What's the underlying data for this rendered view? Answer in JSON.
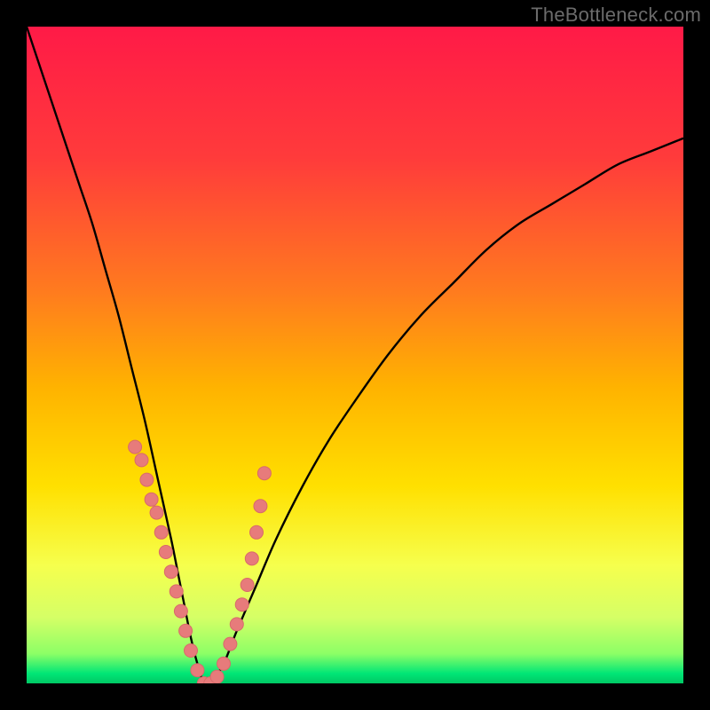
{
  "attribution": "TheBottleneck.com",
  "colors": {
    "frame": "#000000",
    "gradient_stops": [
      {
        "offset": 0.0,
        "color": "#ff1a47"
      },
      {
        "offset": 0.2,
        "color": "#ff3b3b"
      },
      {
        "offset": 0.4,
        "color": "#ff7a1f"
      },
      {
        "offset": 0.55,
        "color": "#ffb300"
      },
      {
        "offset": 0.7,
        "color": "#ffe000"
      },
      {
        "offset": 0.82,
        "color": "#f6ff4d"
      },
      {
        "offset": 0.9,
        "color": "#d5ff66"
      },
      {
        "offset": 0.955,
        "color": "#8cff66"
      },
      {
        "offset": 0.985,
        "color": "#00e676"
      },
      {
        "offset": 1.0,
        "color": "#00c864"
      }
    ],
    "curve": "#000000",
    "marker_fill": "#e77b7b",
    "marker_stroke": "#d86a6a"
  },
  "chart_data": {
    "type": "line",
    "title": "",
    "xlabel": "",
    "ylabel": "",
    "xlim": [
      0,
      100
    ],
    "ylim": [
      0,
      100
    ],
    "series": [
      {
        "name": "bottleneck-curve",
        "x": [
          0,
          2,
          4,
          6,
          8,
          10,
          12,
          14,
          16,
          18,
          20,
          22,
          23,
          24,
          25,
          26,
          27,
          28,
          30,
          32,
          35,
          38,
          42,
          46,
          50,
          55,
          60,
          65,
          70,
          75,
          80,
          85,
          90,
          95,
          100
        ],
        "y": [
          100,
          94,
          88,
          82,
          76,
          70,
          63,
          56,
          48,
          40,
          31,
          22,
          17,
          12,
          7,
          3,
          0,
          0,
          3,
          8,
          15,
          22,
          30,
          37,
          43,
          50,
          56,
          61,
          66,
          70,
          73,
          76,
          79,
          81,
          83
        ]
      }
    ],
    "markers": {
      "name": "sample-points",
      "x": [
        16.5,
        17.5,
        18.3,
        19.0,
        19.8,
        20.5,
        21.2,
        22.0,
        22.8,
        23.5,
        24.2,
        25.0,
        26.0,
        27.0,
        28.0,
        29.0,
        30.0,
        31.0,
        32.0,
        32.8,
        33.6,
        34.3,
        35.0,
        35.6,
        36.2
      ],
      "y": [
        36,
        34,
        31,
        28,
        26,
        23,
        20,
        17,
        14,
        11,
        8,
        5,
        2,
        0,
        0,
        1,
        3,
        6,
        9,
        12,
        15,
        19,
        23,
        27,
        32
      ]
    }
  }
}
